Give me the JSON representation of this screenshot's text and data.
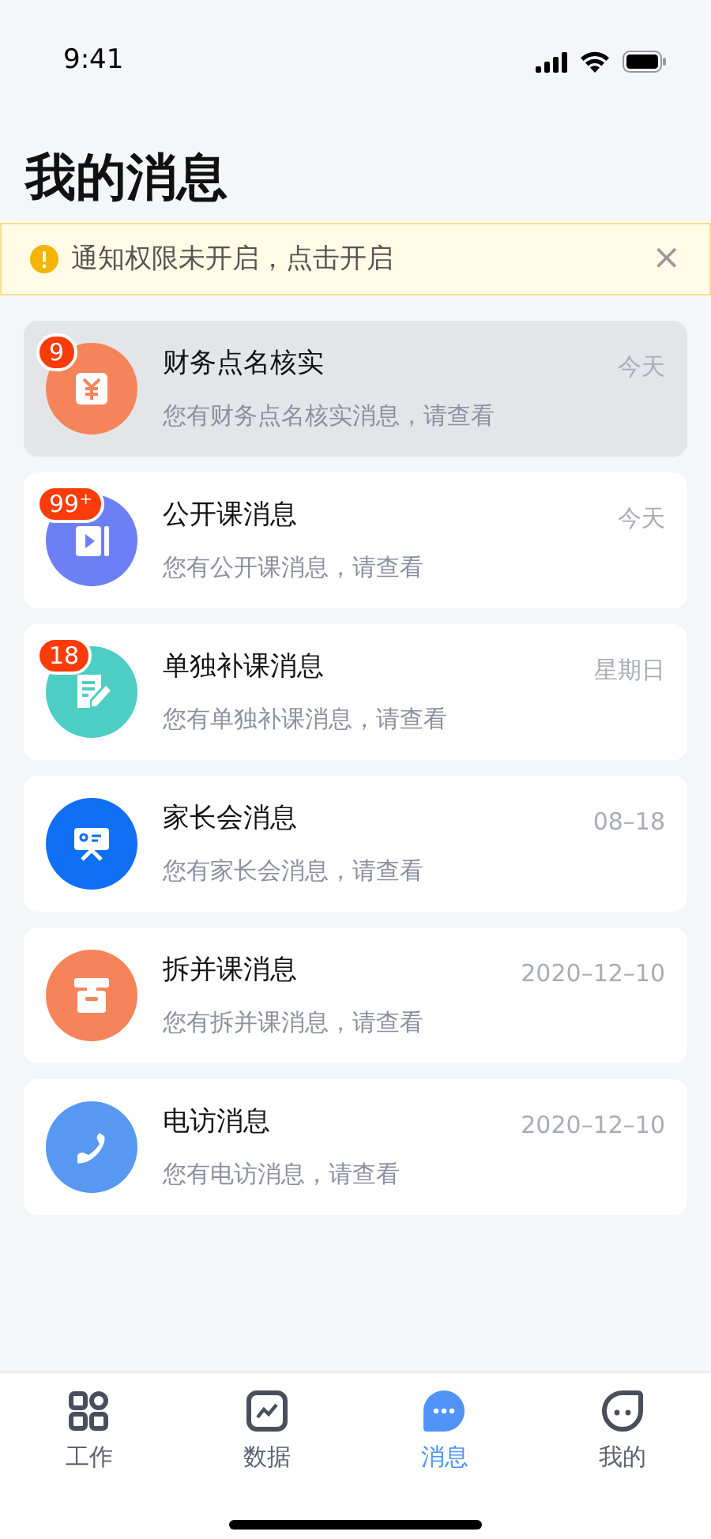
{
  "status_bar": {
    "time": "9:41"
  },
  "title": "我的消息",
  "notice": {
    "text": "通知权限未开启，点击开启",
    "close": "×"
  },
  "messages": [
    {
      "title": "财务点名核实",
      "subtitle": "您有财务点名核实消息，请查看",
      "time": "今天",
      "badge": "9",
      "kind": "money",
      "color": "#f5845a",
      "selected": true
    },
    {
      "title": "公开课消息",
      "subtitle": "您有公开课消息，请查看",
      "time": "今天",
      "badge": "99$^{+}$",
      "kind": "video",
      "color": "#6c7ff5",
      "selected": false
    },
    {
      "title": "单独补课消息",
      "subtitle": "您有单独补课消息，请查看",
      "time": "星期日",
      "badge": "18",
      "kind": "note",
      "color": "#4ecdc4",
      "selected": false
    },
    {
      "title": "家长会消息",
      "subtitle": "您有家长会消息，请查看",
      "time": "08–18",
      "kind": "board",
      "color": "#0f6ff5",
      "selected": false
    },
    {
      "title": "拆并课消息",
      "subtitle": "您有拆并课消息，请查看",
      "time": "2020–12–10",
      "kind": "box",
      "color": "#f5845a",
      "selected": false
    },
    {
      "title": "电访消息",
      "subtitle": "您有电访消息，请查看",
      "time": "2020–12–10",
      "kind": "phone",
      "color": "#5898f2",
      "selected": false
    }
  ],
  "tabs": [
    {
      "label": "工作",
      "kind": "grid",
      "selected": false
    },
    {
      "label": "数据",
      "kind": "chart",
      "selected": false
    },
    {
      "label": "消息",
      "kind": "chat",
      "selected": true
    },
    {
      "label": "我的",
      "kind": "face",
      "selected": false
    }
  ]
}
